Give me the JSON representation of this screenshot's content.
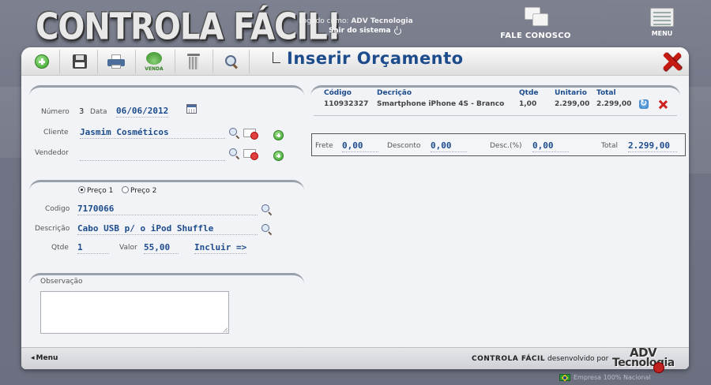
{
  "header": {
    "logo": "CONTROLA FÁCIL!",
    "logged_label": "Logado como:",
    "logged_user": "ADV Tecnologia",
    "logout_label": "Sair do sistema",
    "contact_label": "FALE CONOSCO",
    "menu_label": "MENU"
  },
  "toolbar": {
    "venda_label": "VENDA",
    "page_title": "Inserir Orçamento"
  },
  "form": {
    "numero_label": "Número",
    "numero_value": "3",
    "data_label": "Data",
    "data_value": "06/06/2012",
    "cliente_label": "Cliente",
    "cliente_value": "Jasmim Cosméticos",
    "vendedor_label": "Vendedor",
    "vendedor_value": ""
  },
  "item_form": {
    "preco1_label": "Preço 1",
    "preco2_label": "Preço 2",
    "preco_selected": "Preço 1",
    "codigo_label": "Codigo",
    "codigo_value": "7170066",
    "descricao_label": "Descrição",
    "descricao_value": "Cabo USB p/ o iPod Shuffle",
    "qtde_label": "Qtde",
    "qtde_value": "1",
    "valor_label": "Valor",
    "valor_value": "55,00",
    "incluir_label": "Incluir =>"
  },
  "observacao": {
    "label": "Observação",
    "value": ""
  },
  "items_table": {
    "columns": [
      "Código",
      "Decrição",
      "Qtde",
      "Unitario",
      "Total"
    ],
    "rows": [
      {
        "codigo": "110932327",
        "descricao": "Smartphone iPhone 4S - Branco",
        "qtde": "1,00",
        "unitario": "2.299,00",
        "total": "2.299,00"
      }
    ]
  },
  "totals": {
    "frete_label": "Frete",
    "frete_value": "0,00",
    "desconto_label": "Desconto",
    "desconto_value": "0,00",
    "descpct_label": "Desc.(%)",
    "descpct_value": "0,00",
    "total_label": "Total",
    "total_value": "2.299,00"
  },
  "footer": {
    "menu_label": "Menu",
    "credit_brand": "CONTROLA FÁCIL",
    "credit_text": "desenvolvido por",
    "adv_line1": "ADV",
    "adv_line2": "Tecnologia",
    "nacional": "Empresa 100% Nacional"
  },
  "icons": [
    "add-icon",
    "save-icon",
    "print-icon",
    "venda-icon",
    "trash-icon",
    "search-icon",
    "close-icon",
    "calendar-icon",
    "magnifier-icon",
    "remove-card-icon",
    "plus-icon",
    "refresh-icon",
    "delete-icon",
    "power-icon",
    "chat-icon",
    "menu-grid-icon",
    "flag-icon"
  ],
  "colors": {
    "title_blue": "#1d4c8c",
    "close_red": "#c41a12",
    "green_add": "#3aa22a"
  }
}
